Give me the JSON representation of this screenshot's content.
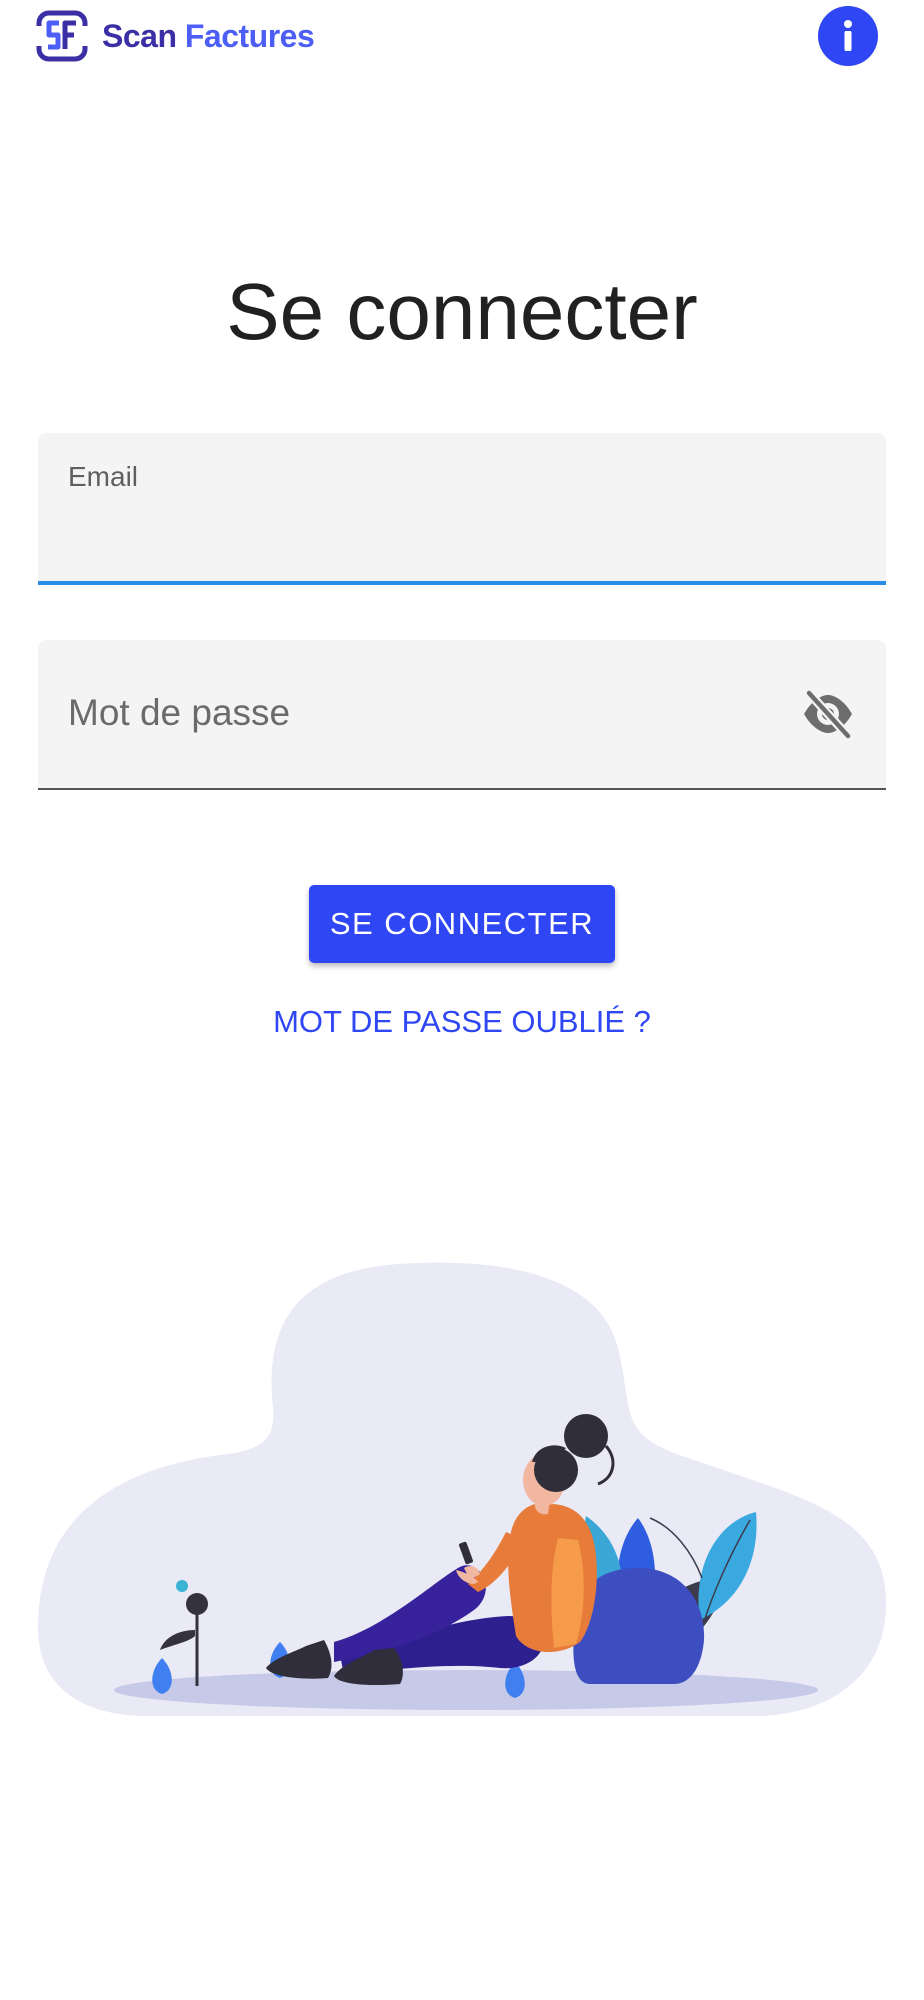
{
  "app": {
    "logo_word_1": "Scan",
    "logo_word_2": "Factures",
    "logo_icon": "sf-logo-icon",
    "info_icon": "info-icon"
  },
  "login": {
    "title": "Se connecter",
    "email_label": "Email",
    "email_value": "",
    "password_placeholder": "Mot de passe",
    "password_toggle_icon": "eye-off-icon",
    "submit_label": "SE CONNECTER",
    "forgot_label": "MOT DE PASSE OUBLIÉ ?"
  },
  "colors": {
    "primary": "#2f46f4",
    "focus_underline": "#2a8ee8",
    "field_background": "#f4f4f4",
    "illustration_blob": "#e9eaf6"
  }
}
